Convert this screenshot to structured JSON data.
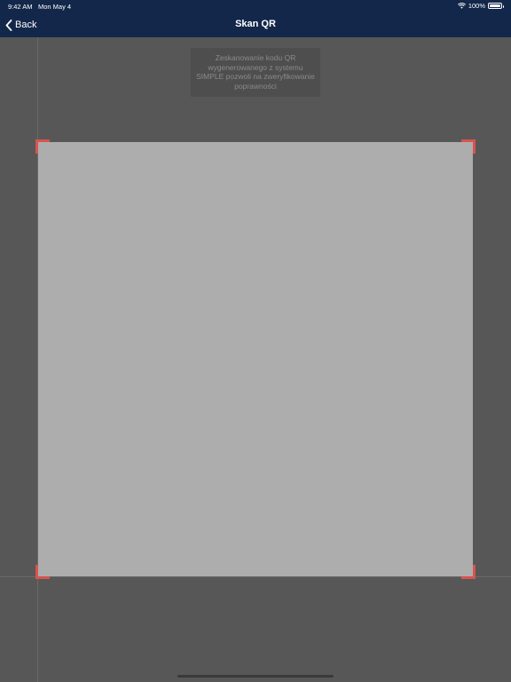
{
  "status_bar": {
    "time": "9:42 AM",
    "date": "Mon May 4",
    "battery": "100%",
    "wifi_icon": "wifi-icon",
    "battery_icon": "battery-icon"
  },
  "nav": {
    "back_label": "Back",
    "back_icon": "chevron-left-icon",
    "title": "Skan QR"
  },
  "scanner": {
    "hint": "Zeskanowanie kodu QR wygenerowanego z systemu SIMPLE pozwoli na zweryfikowanie poprawności",
    "frame_color": "#d9534f"
  },
  "colors": {
    "navbar": "#13274a",
    "background": "#575757",
    "viewfinder": "#adadad"
  }
}
